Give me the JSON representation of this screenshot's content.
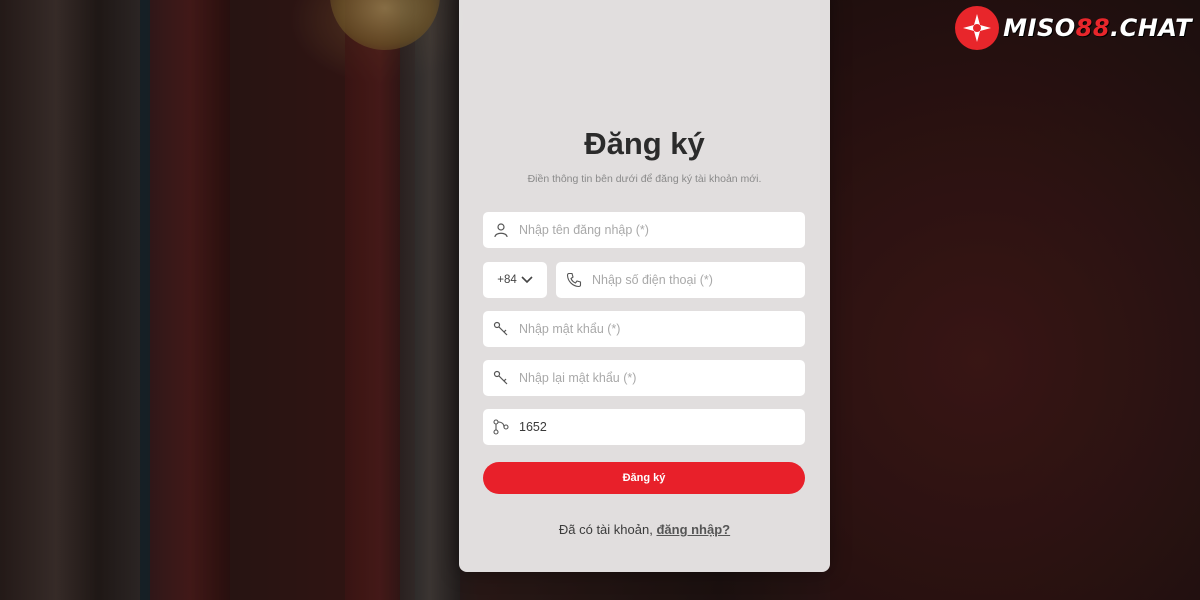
{
  "brand": {
    "logo_text_main": "MISO",
    "logo_text_num": "88",
    "logo_text_tld": ".CHAT",
    "accent_color": "#e8202a"
  },
  "form": {
    "title": "Đăng ký",
    "subtitle": "Điền thông tin bên dưới để đăng ký tài khoản mới.",
    "username_placeholder": "Nhập tên đăng nhập (*)",
    "country_code": "+84",
    "phone_placeholder": "Nhập số điện thoại (*)",
    "password_placeholder": "Nhập mật khẩu (*)",
    "confirm_password_placeholder": "Nhập lại mật khẩu (*)",
    "captcha_value": "1652",
    "submit_label": "Đăng ký",
    "footer_text": "Đã có tài khoản,",
    "login_link": "đăng nhập?"
  },
  "icons": {
    "username": "user-icon",
    "phone": "phone-icon",
    "password": "key-icon",
    "confirm_password": "key-icon",
    "captcha": "captcha-icon",
    "country_dropdown": "chevron-down-icon"
  }
}
